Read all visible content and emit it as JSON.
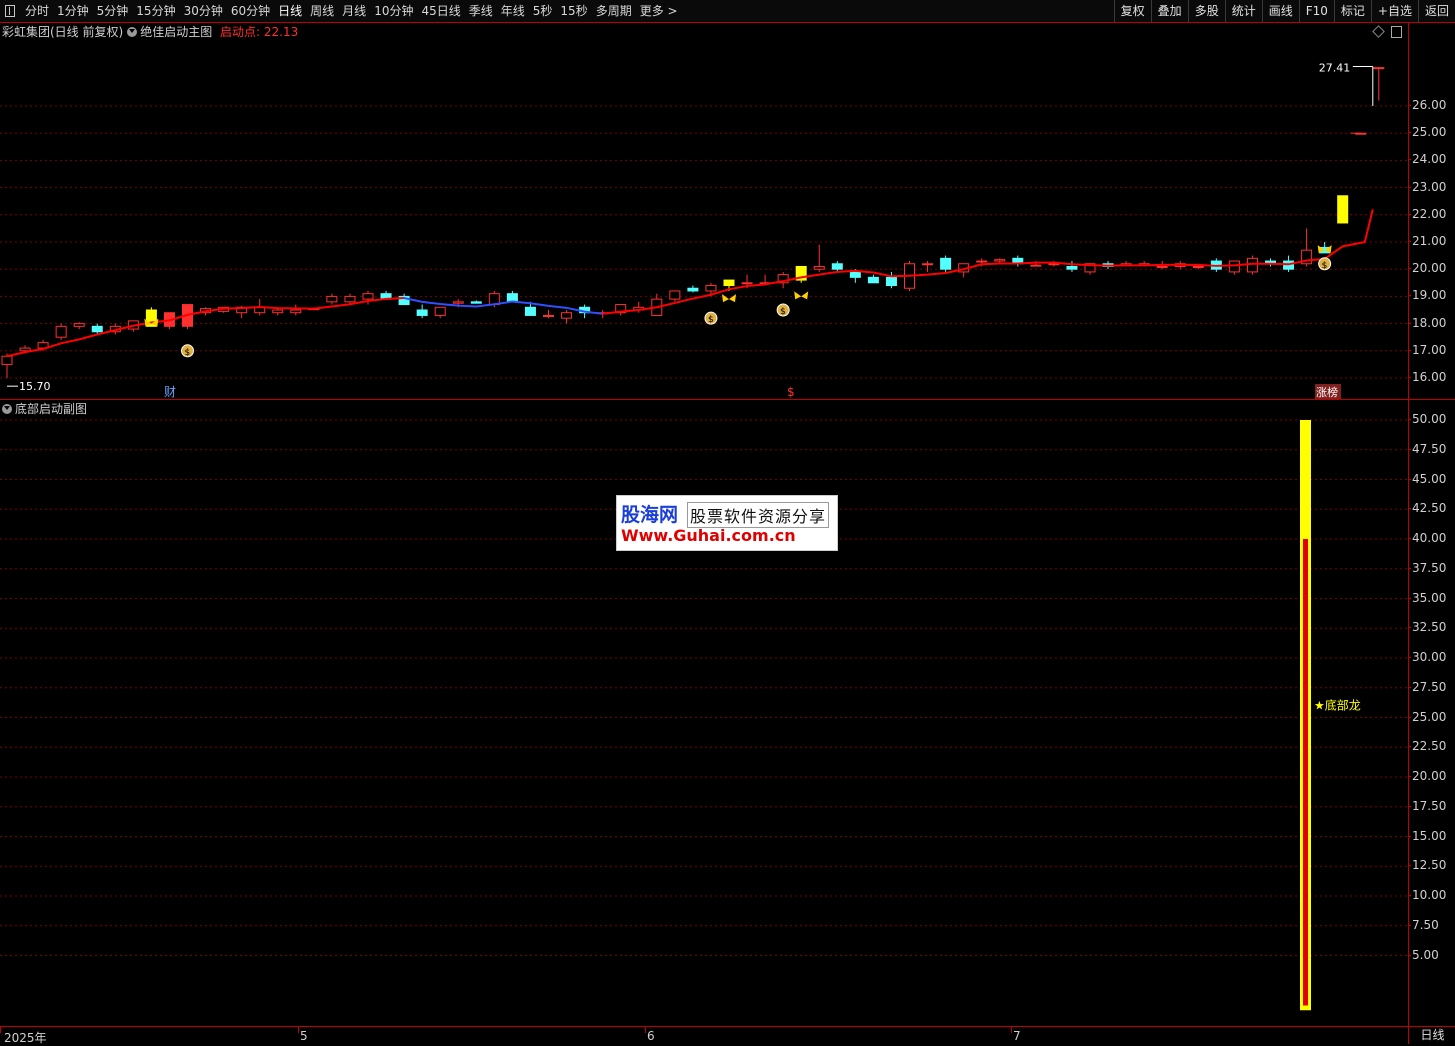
{
  "toolbar": {
    "left_items": [
      "分时",
      "1分钟",
      "5分钟",
      "15分钟",
      "30分钟",
      "60分钟",
      "日线",
      "周线",
      "月线",
      "10分钟",
      "45日线",
      "季线",
      "年线",
      "5秒",
      "15秒",
      "多周期",
      "更多 >"
    ],
    "active": "日线",
    "right_items": [
      "复权",
      "叠加",
      "多股",
      "统计",
      "画线",
      "F10",
      "标记",
      "+自选",
      "返回"
    ]
  },
  "main_title": {
    "stock": "彩虹集团(日线 前复权)",
    "indicator": "绝佳启动主图",
    "start_label": "启动点: 22.13"
  },
  "sub_title": {
    "indicator": "底部启动副图"
  },
  "main_axis": {
    "ticks": [
      "26.00",
      "25.00",
      "24.00",
      "23.00",
      "22.00",
      "21.00",
      "20.00",
      "19.00",
      "18.00",
      "17.00",
      "16.00"
    ]
  },
  "sub_axis": {
    "ticks": [
      "50.00",
      "47.50",
      "45.00",
      "42.50",
      "40.00",
      "37.50",
      "35.00",
      "32.50",
      "30.00",
      "27.50",
      "25.00",
      "22.50",
      "20.00",
      "17.50",
      "15.00",
      "12.50",
      "10.00",
      "7.50",
      "5.00"
    ]
  },
  "annotations": {
    "high_label": "27.41",
    "low_label": "15.70",
    "marker_cai": "财",
    "marker_dollar": "$",
    "marker_zhangting": "涨榜",
    "signal_label": "★底部龙"
  },
  "watermark": {
    "brand": "股海网",
    "tagline": "股票软件资源分享",
    "url": "Www.Guhai.com.cn"
  },
  "bottom": {
    "dates": [
      "2025年",
      "5",
      "6",
      "7"
    ],
    "period": "日线"
  },
  "colors": {
    "up": "#ff3030",
    "down": "#54ffff",
    "signal_yellow": "#ffff00",
    "ma_line": "#ff0000",
    "ma_line_early": "#3050ff",
    "grid": "#7a0000"
  },
  "chart_data": {
    "type": "candlestick",
    "ylim": [
      15.5,
      27.5
    ],
    "candles": [
      [
        16.5,
        16.9,
        16.0,
        16.8
      ],
      [
        17.0,
        17.2,
        16.9,
        17.1
      ],
      [
        17.1,
        17.4,
        17.0,
        17.3
      ],
      [
        17.5,
        18.0,
        17.4,
        17.9
      ],
      [
        17.9,
        18.05,
        17.8,
        18.0
      ],
      [
        17.9,
        18.0,
        17.6,
        17.7
      ],
      [
        17.7,
        18.0,
        17.6,
        17.9
      ],
      [
        17.8,
        18.1,
        17.7,
        18.1
      ],
      [
        17.9,
        18.6,
        17.9,
        18.5
      ],
      [
        17.9,
        18.4,
        17.8,
        18.4
      ],
      [
        17.9,
        18.7,
        17.8,
        18.7
      ],
      [
        18.4,
        18.6,
        18.3,
        18.55
      ],
      [
        18.45,
        18.6,
        18.4,
        18.6
      ],
      [
        18.4,
        18.65,
        18.2,
        18.6
      ],
      [
        18.4,
        18.9,
        18.3,
        18.6
      ],
      [
        18.4,
        18.6,
        18.3,
        18.5
      ],
      [
        18.4,
        18.7,
        18.3,
        18.5
      ],
      [
        18.55,
        18.6,
        18.5,
        18.55
      ],
      [
        18.8,
        19.1,
        18.7,
        19.0
      ],
      [
        18.8,
        19.1,
        18.7,
        19.0
      ],
      [
        18.9,
        19.2,
        18.7,
        19.1
      ],
      [
        19.1,
        19.2,
        18.9,
        18.9
      ],
      [
        19.0,
        19.1,
        18.7,
        18.7
      ],
      [
        18.5,
        18.7,
        18.2,
        18.3
      ],
      [
        18.3,
        18.6,
        18.2,
        18.6
      ],
      [
        18.75,
        18.9,
        18.6,
        18.8
      ],
      [
        18.8,
        18.85,
        18.75,
        18.75
      ],
      [
        18.7,
        19.2,
        18.6,
        19.1
      ],
      [
        19.1,
        19.2,
        18.8,
        18.8
      ],
      [
        18.6,
        18.8,
        18.5,
        18.3
      ],
      [
        18.3,
        18.5,
        18.2,
        18.3
      ],
      [
        18.2,
        18.5,
        18.0,
        18.4
      ],
      [
        18.6,
        18.7,
        18.2,
        18.4
      ],
      [
        18.4,
        18.5,
        18.2,
        18.4
      ],
      [
        18.4,
        18.7,
        18.3,
        18.7
      ],
      [
        18.5,
        18.8,
        18.4,
        18.6
      ],
      [
        18.3,
        19.1,
        18.3,
        18.9
      ],
      [
        18.9,
        19.2,
        18.8,
        19.2
      ],
      [
        19.3,
        19.4,
        19.15,
        19.2
      ],
      [
        19.2,
        19.5,
        19.0,
        19.4
      ],
      [
        19.4,
        19.6,
        19.2,
        19.6
      ],
      [
        19.5,
        19.8,
        19.3,
        19.5
      ],
      [
        19.5,
        19.8,
        19.4,
        19.5
      ],
      [
        19.5,
        19.9,
        19.3,
        19.8
      ],
      [
        19.6,
        20.1,
        19.5,
        20.1
      ],
      [
        20.0,
        20.9,
        19.9,
        20.1
      ],
      [
        20.2,
        20.3,
        19.9,
        20.0
      ],
      [
        19.9,
        20.0,
        19.5,
        19.7
      ],
      [
        19.7,
        19.8,
        19.5,
        19.5
      ],
      [
        19.7,
        19.9,
        19.3,
        19.4
      ],
      [
        19.3,
        20.3,
        19.2,
        20.2
      ],
      [
        20.2,
        20.3,
        19.9,
        20.2
      ],
      [
        20.4,
        20.5,
        19.9,
        20.0
      ],
      [
        19.9,
        20.2,
        19.7,
        20.2
      ],
      [
        20.3,
        20.4,
        20.1,
        20.3
      ],
      [
        20.3,
        20.4,
        20.2,
        20.35
      ],
      [
        20.4,
        20.5,
        20.1,
        20.2
      ],
      [
        20.15,
        20.3,
        20.1,
        20.15
      ],
      [
        20.2,
        20.3,
        20.1,
        20.2
      ],
      [
        20.1,
        20.3,
        19.9,
        20.0
      ],
      [
        19.9,
        20.2,
        19.8,
        20.2
      ],
      [
        20.2,
        20.3,
        20.0,
        20.1
      ],
      [
        20.15,
        20.3,
        20.1,
        20.2
      ],
      [
        20.15,
        20.3,
        20.1,
        20.2
      ],
      [
        20.1,
        20.3,
        20.0,
        20.1
      ],
      [
        20.1,
        20.3,
        20.0,
        20.2
      ],
      [
        20.1,
        20.2,
        20.0,
        20.1
      ],
      [
        20.3,
        20.4,
        19.9,
        20.0
      ],
      [
        19.9,
        20.2,
        19.8,
        20.3
      ],
      [
        19.9,
        20.5,
        19.8,
        20.4
      ],
      [
        20.3,
        20.4,
        20.1,
        20.2
      ],
      [
        20.3,
        20.5,
        19.9,
        20.0
      ],
      [
        20.2,
        21.5,
        20.1,
        20.7
      ],
      [
        20.8,
        21.0,
        20.6,
        20.6
      ],
      [
        21.7,
        22.7,
        21.7,
        22.7
      ],
      [
        25.0,
        25.0,
        25.0,
        25.0
      ],
      [
        27.41,
        27.41,
        26.2,
        27.41
      ]
    ]
  }
}
